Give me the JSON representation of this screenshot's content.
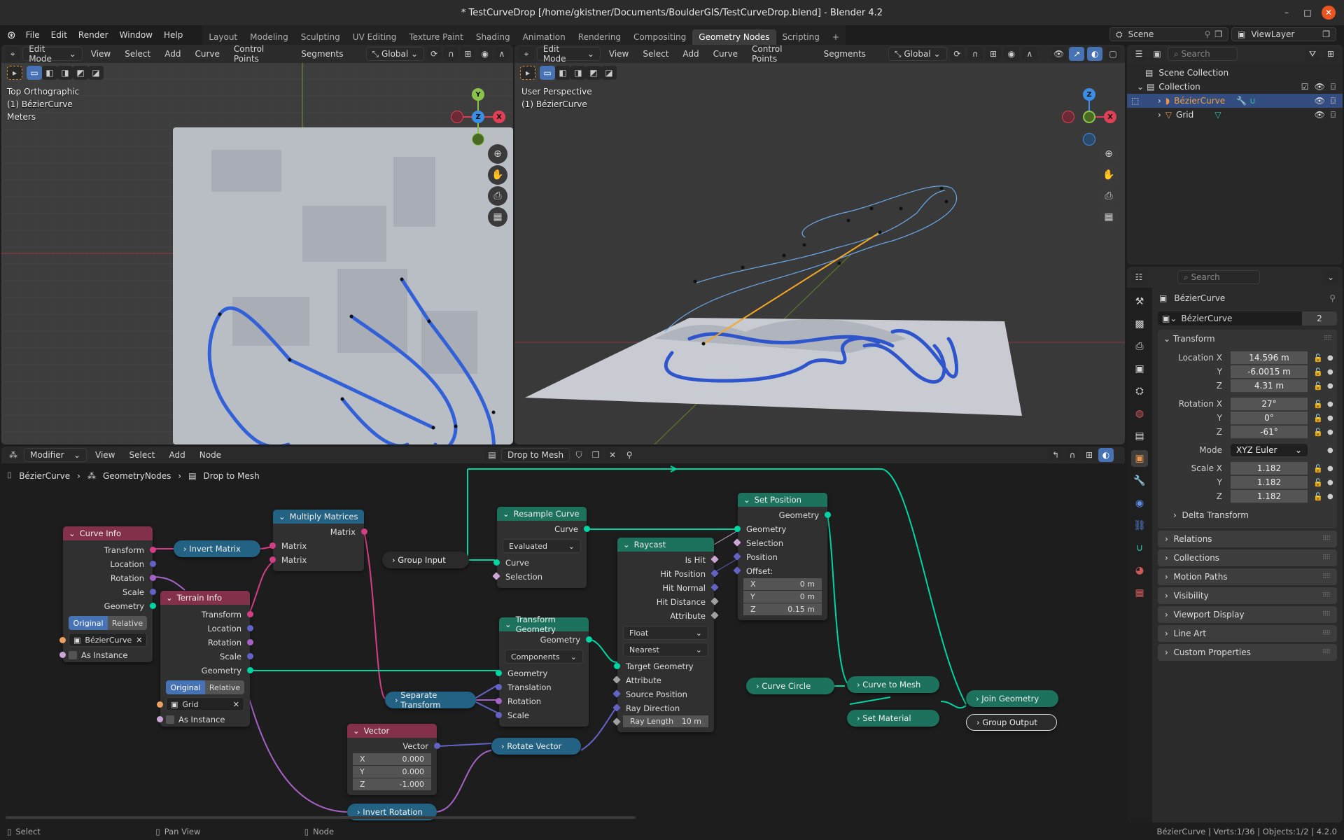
{
  "window": {
    "title": "* TestCurveDrop [/home/gkistner/Documents/BoulderGIS/TestCurveDrop.blend] - Blender 4.2",
    "minimize": "–",
    "maximize": "□",
    "close": "✕"
  },
  "menubar": {
    "menus": [
      "File",
      "Edit",
      "Render",
      "Window",
      "Help"
    ],
    "workspaces": [
      "Layout",
      "Modeling",
      "Sculpting",
      "UV Editing",
      "Texture Paint",
      "Shading",
      "Animation",
      "Rendering",
      "Compositing",
      "Geometry Nodes",
      "Scripting"
    ],
    "active_workspace": "Geometry Nodes",
    "add_tab": "+",
    "scene": "Scene",
    "view_layer": "ViewLayer"
  },
  "viewport_left": {
    "mode": "Edit Mode",
    "menus": [
      "View",
      "Select",
      "Add",
      "Curve",
      "Control Points",
      "Segments"
    ],
    "orientation": "Global",
    "info": [
      "Top Orthographic",
      "(1) BézierCurve",
      "Meters"
    ],
    "gizmo": {
      "y": "Y",
      "z": "Z",
      "x": "X"
    }
  },
  "viewport_right": {
    "mode": "Edit Mode",
    "menus": [
      "View",
      "Select",
      "Add",
      "Curve",
      "Control Points",
      "Segments"
    ],
    "orientation": "Global",
    "info": [
      "User Perspective",
      "(1) BézierCurve"
    ],
    "gizmo": {
      "z": "Z",
      "x": "X"
    }
  },
  "node_editor": {
    "editor_type": "Modifier",
    "menus": [
      "View",
      "Select",
      "Add",
      "Node"
    ],
    "node_group": "Drop to Mesh",
    "breadcrumb": [
      "BézierCurve",
      "GeometryNodes",
      "Drop to Mesh"
    ],
    "nodes": {
      "curve_info": {
        "title": "Curve Info",
        "outputs": [
          "Transform",
          "Location",
          "Rotation",
          "Scale",
          "Geometry"
        ],
        "toggle": [
          "Original",
          "Relative"
        ],
        "active_toggle": "Original",
        "object": "BézierCurve",
        "as_instance": "As Instance"
      },
      "terrain_info": {
        "title": "Terrain Info",
        "outputs": [
          "Transform",
          "Location",
          "Rotation",
          "Scale",
          "Geometry"
        ],
        "toggle": [
          "Original",
          "Relative"
        ],
        "active_toggle": "Original",
        "object": "Grid",
        "as_instance": "As Instance"
      },
      "invert_matrix": {
        "title": "Invert Matrix"
      },
      "multiply_matrices": {
        "title": "Multiply Matrices",
        "output": "Matrix",
        "inputs": [
          "Matrix",
          "Matrix"
        ]
      },
      "group_input": {
        "title": "Group Input"
      },
      "resample_curve": {
        "title": "Resample Curve",
        "output": "Curve",
        "mode": "Evaluated",
        "inputs": [
          "Curve",
          "Selection"
        ]
      },
      "transform_geometry": {
        "title": "Transform Geometry",
        "output": "Geometry",
        "mode": "Components",
        "inputs": [
          "Geometry",
          "Translation",
          "Rotation",
          "Scale"
        ]
      },
      "separate_transform": {
        "title": "Separate Transform"
      },
      "raycast": {
        "title": "Raycast",
        "outputs": [
          "Is Hit",
          "Hit Position",
          "Hit Normal",
          "Hit Distance",
          "Attribute"
        ],
        "data_type": "Float",
        "mapping": "Nearest",
        "inputs": [
          "Target Geometry",
          "Attribute",
          "Source Position",
          "Ray Direction"
        ],
        "ray_length_label": "Ray Length",
        "ray_length": "10 m"
      },
      "set_position": {
        "title": "Set Position",
        "output": "Geometry",
        "inputs": [
          "Geometry",
          "Selection",
          "Position",
          "Offset:"
        ],
        "offset": [
          {
            "axis": "X",
            "value": "0 m"
          },
          {
            "axis": "Y",
            "value": "0 m"
          },
          {
            "axis": "Z",
            "value": "0.15 m"
          }
        ]
      },
      "vector": {
        "title": "Vector",
        "output": "Vector",
        "values": [
          {
            "axis": "X",
            "value": "0.000"
          },
          {
            "axis": "Y",
            "value": "0.000"
          },
          {
            "axis": "Z",
            "value": "-1.000"
          }
        ]
      },
      "rotate_vector": {
        "title": "Rotate Vector"
      },
      "invert_rotation": {
        "title": "Invert Rotation"
      },
      "curve_circle": {
        "title": "Curve Circle"
      },
      "curve_to_mesh": {
        "title": "Curve to Mesh"
      },
      "set_material": {
        "title": "Set Material"
      },
      "join_geometry": {
        "title": "Join Geometry"
      },
      "group_output": {
        "title": "Group Output"
      }
    }
  },
  "outliner": {
    "search_placeholder": "Search",
    "root": "Scene Collection",
    "collection": "Collection",
    "items": [
      {
        "name": "BézierCurve",
        "selected": true
      },
      {
        "name": "Grid",
        "selected": false
      }
    ]
  },
  "properties": {
    "search_placeholder": "Search",
    "object_name": "BézierCurve",
    "datablock_name": "BézierCurve",
    "users": "2",
    "transform_label": "Transform",
    "location": {
      "label": "Location X",
      "x": "14.596 m",
      "y": "-6.0015 m",
      "z": "4.31 m"
    },
    "rotation": {
      "label": "Rotation X",
      "x": "27°",
      "y": "0°",
      "z": "-61°"
    },
    "mode_label": "Mode",
    "mode": "XYZ Euler",
    "scale": {
      "label": "Scale X",
      "x": "1.182",
      "y": "1.182",
      "z": "1.182"
    },
    "axis_labels": {
      "y": "Y",
      "z": "Z"
    },
    "delta_transform": "Delta Transform",
    "panels": [
      "Relations",
      "Collections",
      "Motion Paths",
      "Visibility",
      "Viewport Display",
      "Line Art",
      "Custom Properties"
    ]
  },
  "statusbar": {
    "hints": [
      "Select",
      "Pan View",
      "Node"
    ],
    "info": "BézierCurve | Verts:1/36 | Objects:1/2 | 4.2.0"
  }
}
